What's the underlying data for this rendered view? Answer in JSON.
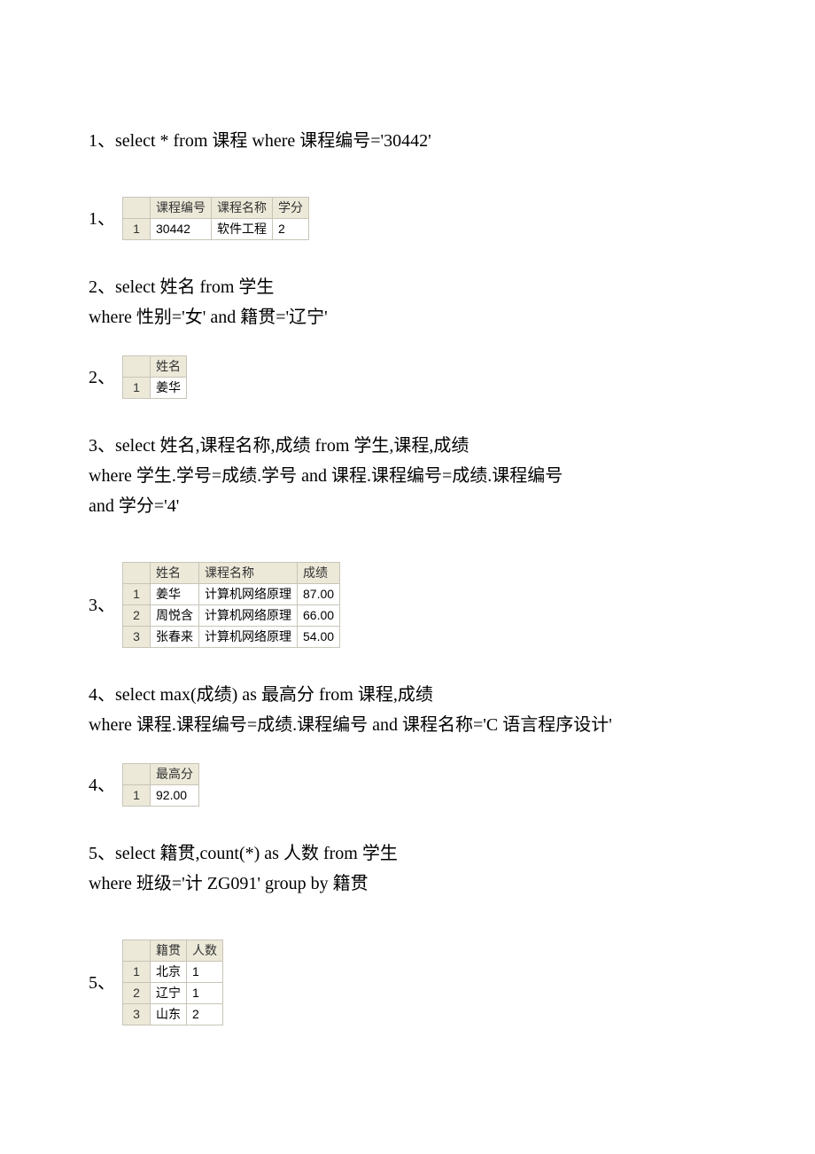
{
  "q1": {
    "text": "1、select * from 课程 where 课程编号='30442'",
    "label": "1、",
    "headers": [
      "课程编号",
      "课程名称",
      "学分"
    ],
    "rows": [
      {
        "n": "1",
        "cells": [
          "30442",
          "软件工程",
          "2"
        ]
      }
    ]
  },
  "q2": {
    "line1": "2、select 姓名 from 学生",
    "line2": "where 性别='女' and 籍贯='辽宁'",
    "label": "2、",
    "headers": [
      "姓名"
    ],
    "rows": [
      {
        "n": "1",
        "cells": [
          "姜华"
        ]
      }
    ]
  },
  "q3": {
    "line1": "3、select 姓名,课程名称,成绩 from 学生,课程,成绩",
    "line2": "where 学生.学号=成绩.学号 and 课程.课程编号=成绩.课程编号",
    "line3": "and 学分='4'",
    "label": "3、",
    "headers": [
      "姓名",
      "课程名称",
      "成绩"
    ],
    "rows": [
      {
        "n": "1",
        "cells": [
          "姜华",
          "计算机网络原理",
          "87.00"
        ]
      },
      {
        "n": "2",
        "cells": [
          "周悦含",
          "计算机网络原理",
          "66.00"
        ]
      },
      {
        "n": "3",
        "cells": [
          "张春来",
          "计算机网络原理",
          "54.00"
        ]
      }
    ]
  },
  "q4": {
    "line1": "4、select max(成绩) as 最高分 from 课程,成绩",
    "line2": "where 课程.课程编号=成绩.课程编号 and 课程名称='C 语言程序设计'",
    "label": "4、",
    "headers": [
      "最高分"
    ],
    "rows": [
      {
        "n": "1",
        "cells": [
          "92.00"
        ]
      }
    ]
  },
  "q5": {
    "line1": "5、select 籍贯,count(*)   as 人数 from 学生",
    "line2": "where 班级='计 ZG091'   group by 籍贯",
    "label": "5、",
    "headers": [
      "籍贯",
      "人数"
    ],
    "rows": [
      {
        "n": "1",
        "cells": [
          "北京",
          "1"
        ]
      },
      {
        "n": "2",
        "cells": [
          "辽宁",
          "1"
        ]
      },
      {
        "n": "3",
        "cells": [
          "山东",
          "2"
        ]
      }
    ]
  }
}
